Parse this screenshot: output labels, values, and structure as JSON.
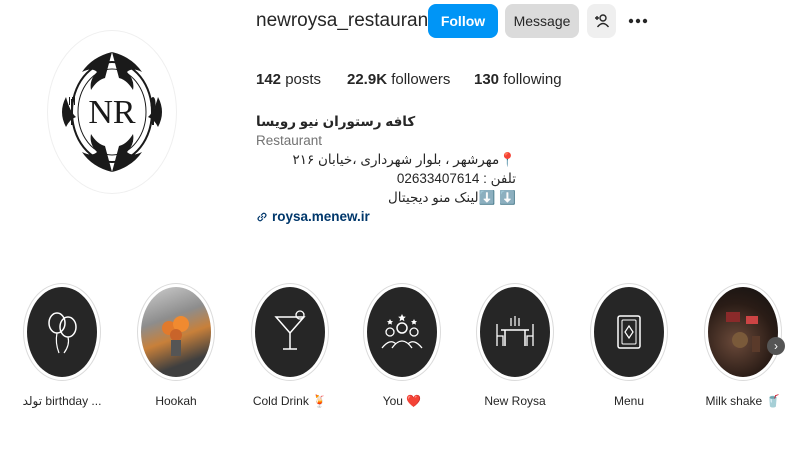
{
  "profile": {
    "username": "newroysa_restaurant",
    "logo_text": "NR",
    "follow_label": "Follow",
    "message_label": "Message",
    "stats": [
      {
        "count": "142",
        "label": "posts"
      },
      {
        "count": "22.9K",
        "label": "followers"
      },
      {
        "count": "130",
        "label": "following"
      }
    ],
    "bio": {
      "name": "کافه رستوران نیو رویسا",
      "category": "Restaurant",
      "address": "📍مهرشهر ، بلوار شهرداری ،خیابان ۲۱۶",
      "phone": "تلفن : 02633407614",
      "menu_link_text": "⬇️ ⬇️لینک منو دیجیتال",
      "website": "roysa.menew.ir"
    }
  },
  "highlights": [
    {
      "label": "تولد birthday ...",
      "icon": "balloons-icon",
      "bg": "#262626"
    },
    {
      "label": "Hookah",
      "icon": "photo-thumbnail",
      "bg": "#8a7a6a"
    },
    {
      "label": "Cold Drink 🍹",
      "icon": "cocktail-icon",
      "bg": "#262626"
    },
    {
      "label": "You ❤️",
      "icon": "people-icon",
      "bg": "#262626"
    },
    {
      "label": "New Roysa",
      "icon": "table-icon",
      "bg": "#262626"
    },
    {
      "label": "Menu",
      "icon": "menu-card-icon",
      "bg": "#262626"
    },
    {
      "label": "Milk shake 🥤",
      "icon": "photo-thumbnail",
      "bg": "#3a2a22"
    }
  ],
  "colors": {
    "follow": "#0095f6",
    "message": "#dbdbdb",
    "link": "#00376b"
  }
}
